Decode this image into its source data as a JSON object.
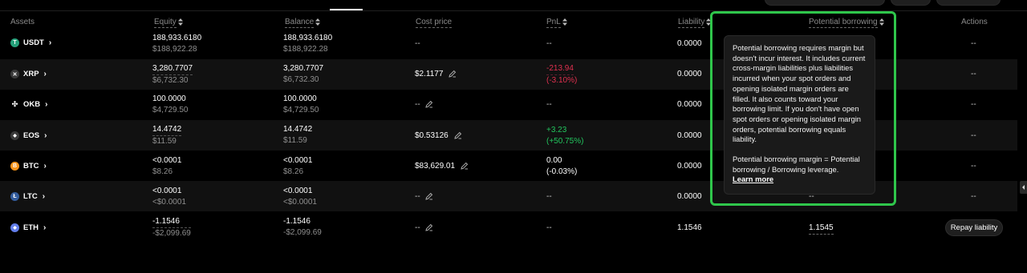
{
  "table": {
    "headers": {
      "assets": "Assets",
      "equity": "Equity",
      "balance": "Balance",
      "cost_price": "Cost price",
      "pnl": "PnL",
      "liability": "Liability",
      "potential_borrowing": "Potential borrowing",
      "actions": "Actions"
    },
    "rows": [
      {
        "asset": "USDT",
        "icon": "tether-icon",
        "color": "#26a17b",
        "glyph": "T",
        "equity": "188,933.6180",
        "equity_usd": "$188,922.28",
        "balance": "188,933.6180",
        "balance_usd": "$188,922.28",
        "cost_price": "--",
        "pnl": "--",
        "pnl_pct": "",
        "liability": "0.0000",
        "potential": "",
        "action": "--"
      },
      {
        "asset": "XRP",
        "icon": "xrp-icon",
        "color": "#3a3a3a",
        "glyph": "✕",
        "equity": "3,280.7707",
        "equity_usd": "$6,732.30",
        "balance": "3,280.7707",
        "balance_usd": "$6,732.30",
        "cost_price": "$2.1177",
        "pnl": "-213.94",
        "pnl_pct": "(-3.10%)",
        "liability": "0.0000",
        "potential": "",
        "action": "--"
      },
      {
        "asset": "OKB",
        "icon": "okb-icon",
        "color": "#000000",
        "glyph": "✣",
        "equity": "100.0000",
        "equity_usd": "$4,729.50",
        "balance": "100.0000",
        "balance_usd": "$4,729.50",
        "cost_price": "--",
        "pnl": "--",
        "pnl_pct": "",
        "liability": "0.0000",
        "potential": "",
        "action": "--"
      },
      {
        "asset": "EOS",
        "icon": "eos-icon",
        "color": "#3a3a3a",
        "glyph": "◆",
        "equity": "14.4742",
        "equity_usd": "$11.59",
        "balance": "14.4742",
        "balance_usd": "$11.59",
        "cost_price": "$0.53126",
        "pnl": "+3.23",
        "pnl_pct": "(+50.75%)",
        "liability": "0.0000",
        "potential": "",
        "action": "--"
      },
      {
        "asset": "BTC",
        "icon": "bitcoin-icon",
        "color": "#f7931a",
        "glyph": "B",
        "equity": "<0.0001",
        "equity_usd": "$8.26",
        "balance": "<0.0001",
        "balance_usd": "$8.26",
        "cost_price": "$83,629.01",
        "pnl": "0.00",
        "pnl_pct": "(-0.03%)",
        "liability": "0.0000",
        "potential": "",
        "action": "--"
      },
      {
        "asset": "LTC",
        "icon": "litecoin-icon",
        "color": "#345d9d",
        "glyph": "Ł",
        "equity": "<0.0001",
        "equity_usd": "<$0.0001",
        "balance": "<0.0001",
        "balance_usd": "<$0.0001",
        "cost_price": "--",
        "pnl": "--",
        "pnl_pct": "",
        "liability": "0.0000",
        "potential": "--",
        "action": "--"
      },
      {
        "asset": "ETH",
        "icon": "ethereum-icon",
        "color": "#627eea",
        "glyph": "◆",
        "equity": "-1.1546",
        "equity_usd": "-$2,099.69",
        "balance": "-1.1546",
        "balance_usd": "-$2,099.69",
        "cost_price": "--",
        "pnl": "--",
        "pnl_pct": "",
        "liability": "1.1546",
        "potential": "1.1545",
        "action": "Repay liability"
      }
    ]
  },
  "tooltip": {
    "paragraph1": "Potential borrowing requires margin but doesn't incur interest. It includes current cross-margin liabilities plus liabilities incurred when your spot orders and opening isolated margin orders are filled. It also counts toward your borrowing limit. If you don't have open spot orders or opening isolated margin orders, potential borrowing equals liability.",
    "paragraph2": "Potential borrowing margin = Potential borrowing / Borrowing leverage.",
    "learn_more": "Learn more"
  },
  "colors": {
    "negative": "#e0304f",
    "positive": "#22c55e",
    "highlight": "#2fc64b"
  }
}
